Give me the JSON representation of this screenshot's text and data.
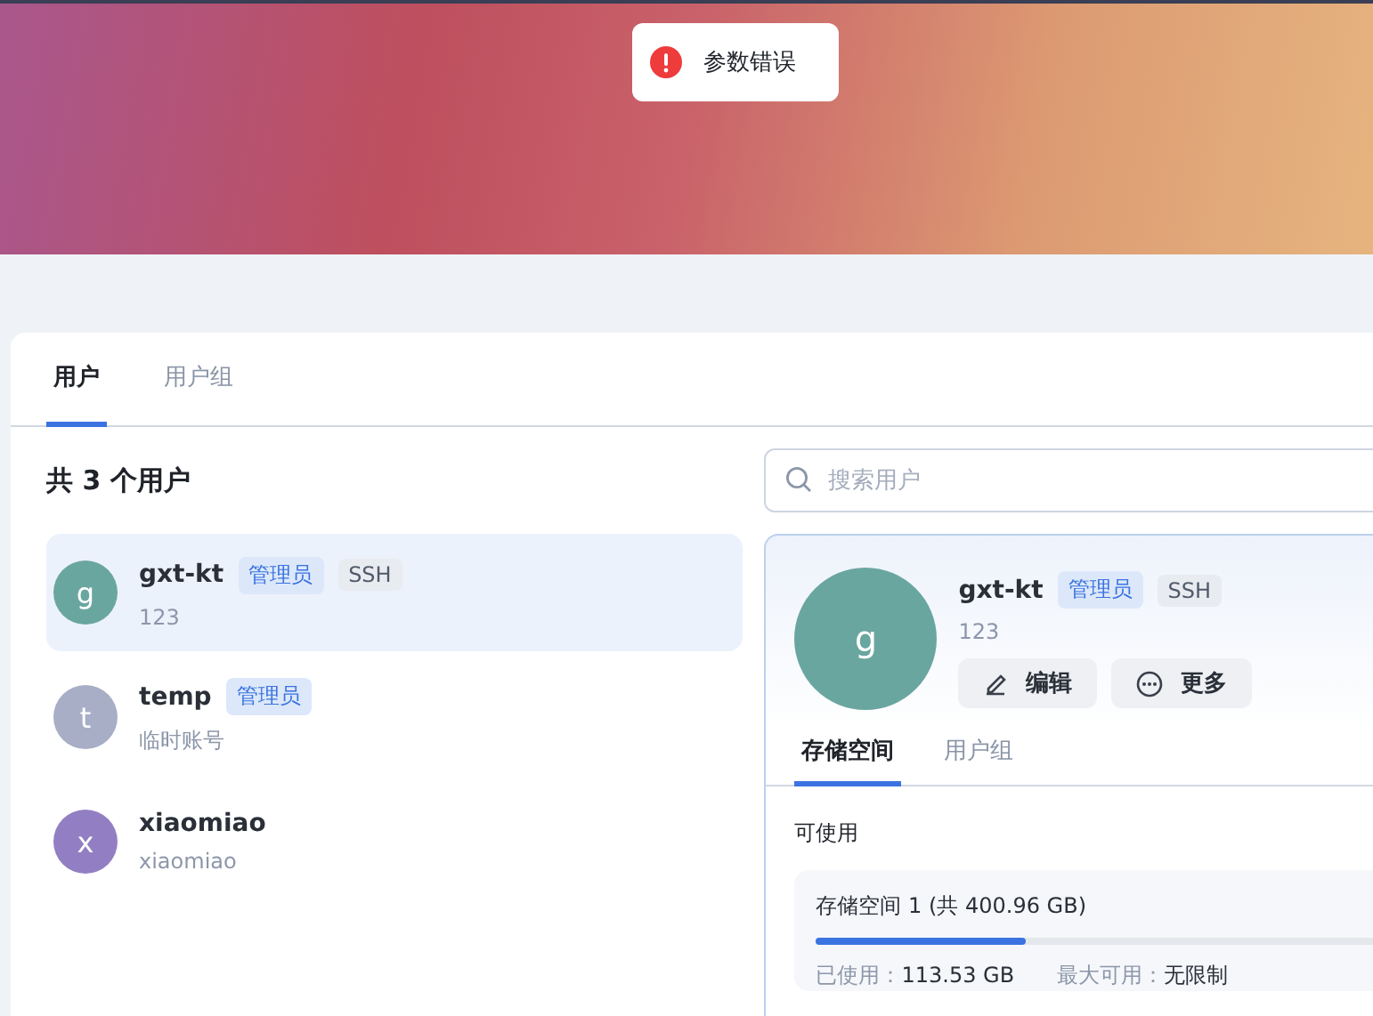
{
  "toast": {
    "kind": "error",
    "message": "参数错误"
  },
  "tabs": [
    {
      "label": "用户",
      "selected": true
    },
    {
      "label": "用户组",
      "selected": false
    }
  ],
  "summary": "共 3 个用户",
  "search": {
    "placeholder": "搜索用户"
  },
  "users": [
    {
      "initial": "g",
      "name": "gxt-kt",
      "note": "123",
      "color": "#6aa6a0",
      "selected": true,
      "tags": [
        {
          "label": "管理员",
          "kind": "role"
        },
        {
          "label": "SSH",
          "kind": "access"
        }
      ]
    },
    {
      "initial": "t",
      "name": "temp",
      "note": "临时账号",
      "color": "#a7aec6",
      "selected": false,
      "tags": [
        {
          "label": "管理员",
          "kind": "role"
        }
      ]
    },
    {
      "initial": "x",
      "name": "xiaomiao",
      "note": "xiaomiao",
      "color": "#927fc3",
      "selected": false
    }
  ],
  "detail": {
    "initial": "g",
    "name": "gxt-kt",
    "note": "123",
    "tags": [
      {
        "label": "管理员",
        "kind": "role"
      },
      {
        "label": "SSH",
        "kind": "access"
      }
    ],
    "actions": [
      {
        "label": "编辑",
        "kind": "edit"
      },
      {
        "label": "更多",
        "kind": "more"
      }
    ],
    "tabs": [
      {
        "label": "存储空间",
        "selected": true
      },
      {
        "label": "用户组",
        "selected": false
      }
    ],
    "section": "可使用",
    "storage": {
      "title": "存储空间 1 (共 400.96 GB)",
      "level": 0.283,
      "used_label": "已使用：",
      "used": "113.53 GB",
      "max_label": "最大可用：",
      "max": "无限制"
    }
  }
}
